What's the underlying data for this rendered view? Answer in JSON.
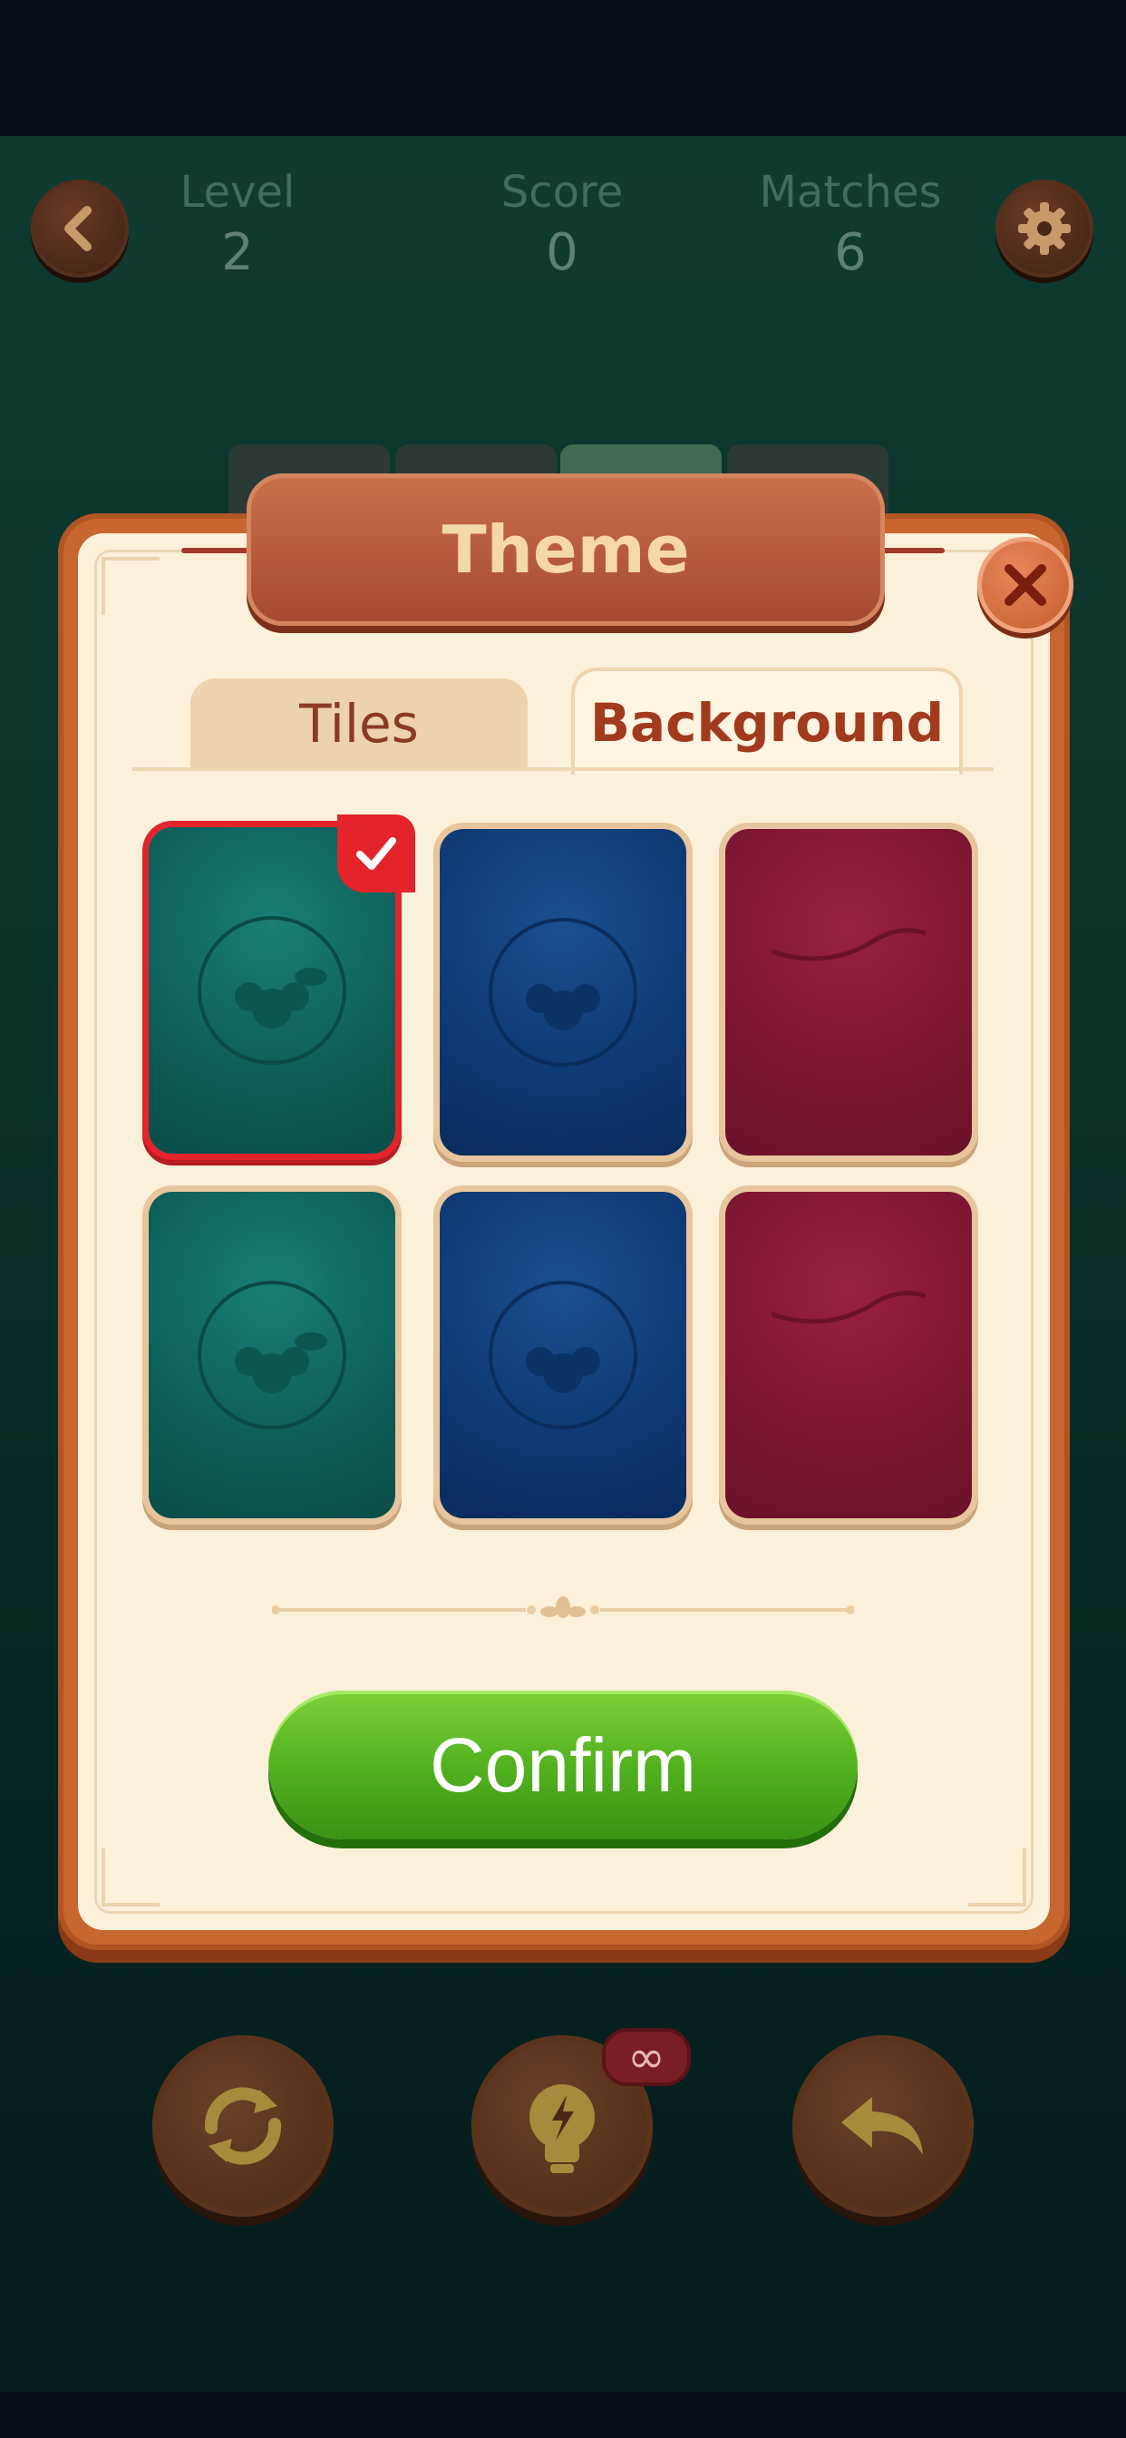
{
  "hud": {
    "level_label": "Level",
    "level_value": "2",
    "score_label": "Score",
    "score_value": "0",
    "matches_label": "Matches",
    "matches_value": "6"
  },
  "dialog": {
    "title": "Theme",
    "tabs": [
      {
        "label": "Tiles",
        "active": false
      },
      {
        "label": "Background",
        "active": true
      }
    ],
    "backgrounds": [
      {
        "color": "teal",
        "selected": true
      },
      {
        "color": "blue",
        "selected": false
      },
      {
        "color": "crimson",
        "selected": false
      },
      {
        "color": "teal",
        "selected": false
      },
      {
        "color": "blue",
        "selected": false
      },
      {
        "color": "crimson",
        "selected": false
      }
    ],
    "confirm_label": "Confirm"
  },
  "hint_badge": "∞",
  "icons": {
    "back": "chevron-left-icon",
    "settings": "gear-icon",
    "close": "close-icon",
    "shuffle": "shuffle-icon",
    "hint": "lightbulb-icon",
    "undo": "undo-icon",
    "check": "check-icon"
  },
  "colors": {
    "panel": "#fbf0da",
    "panel_frame": "#c8662f",
    "selected_border": "#e3242b",
    "confirm": "#53b21f"
  }
}
